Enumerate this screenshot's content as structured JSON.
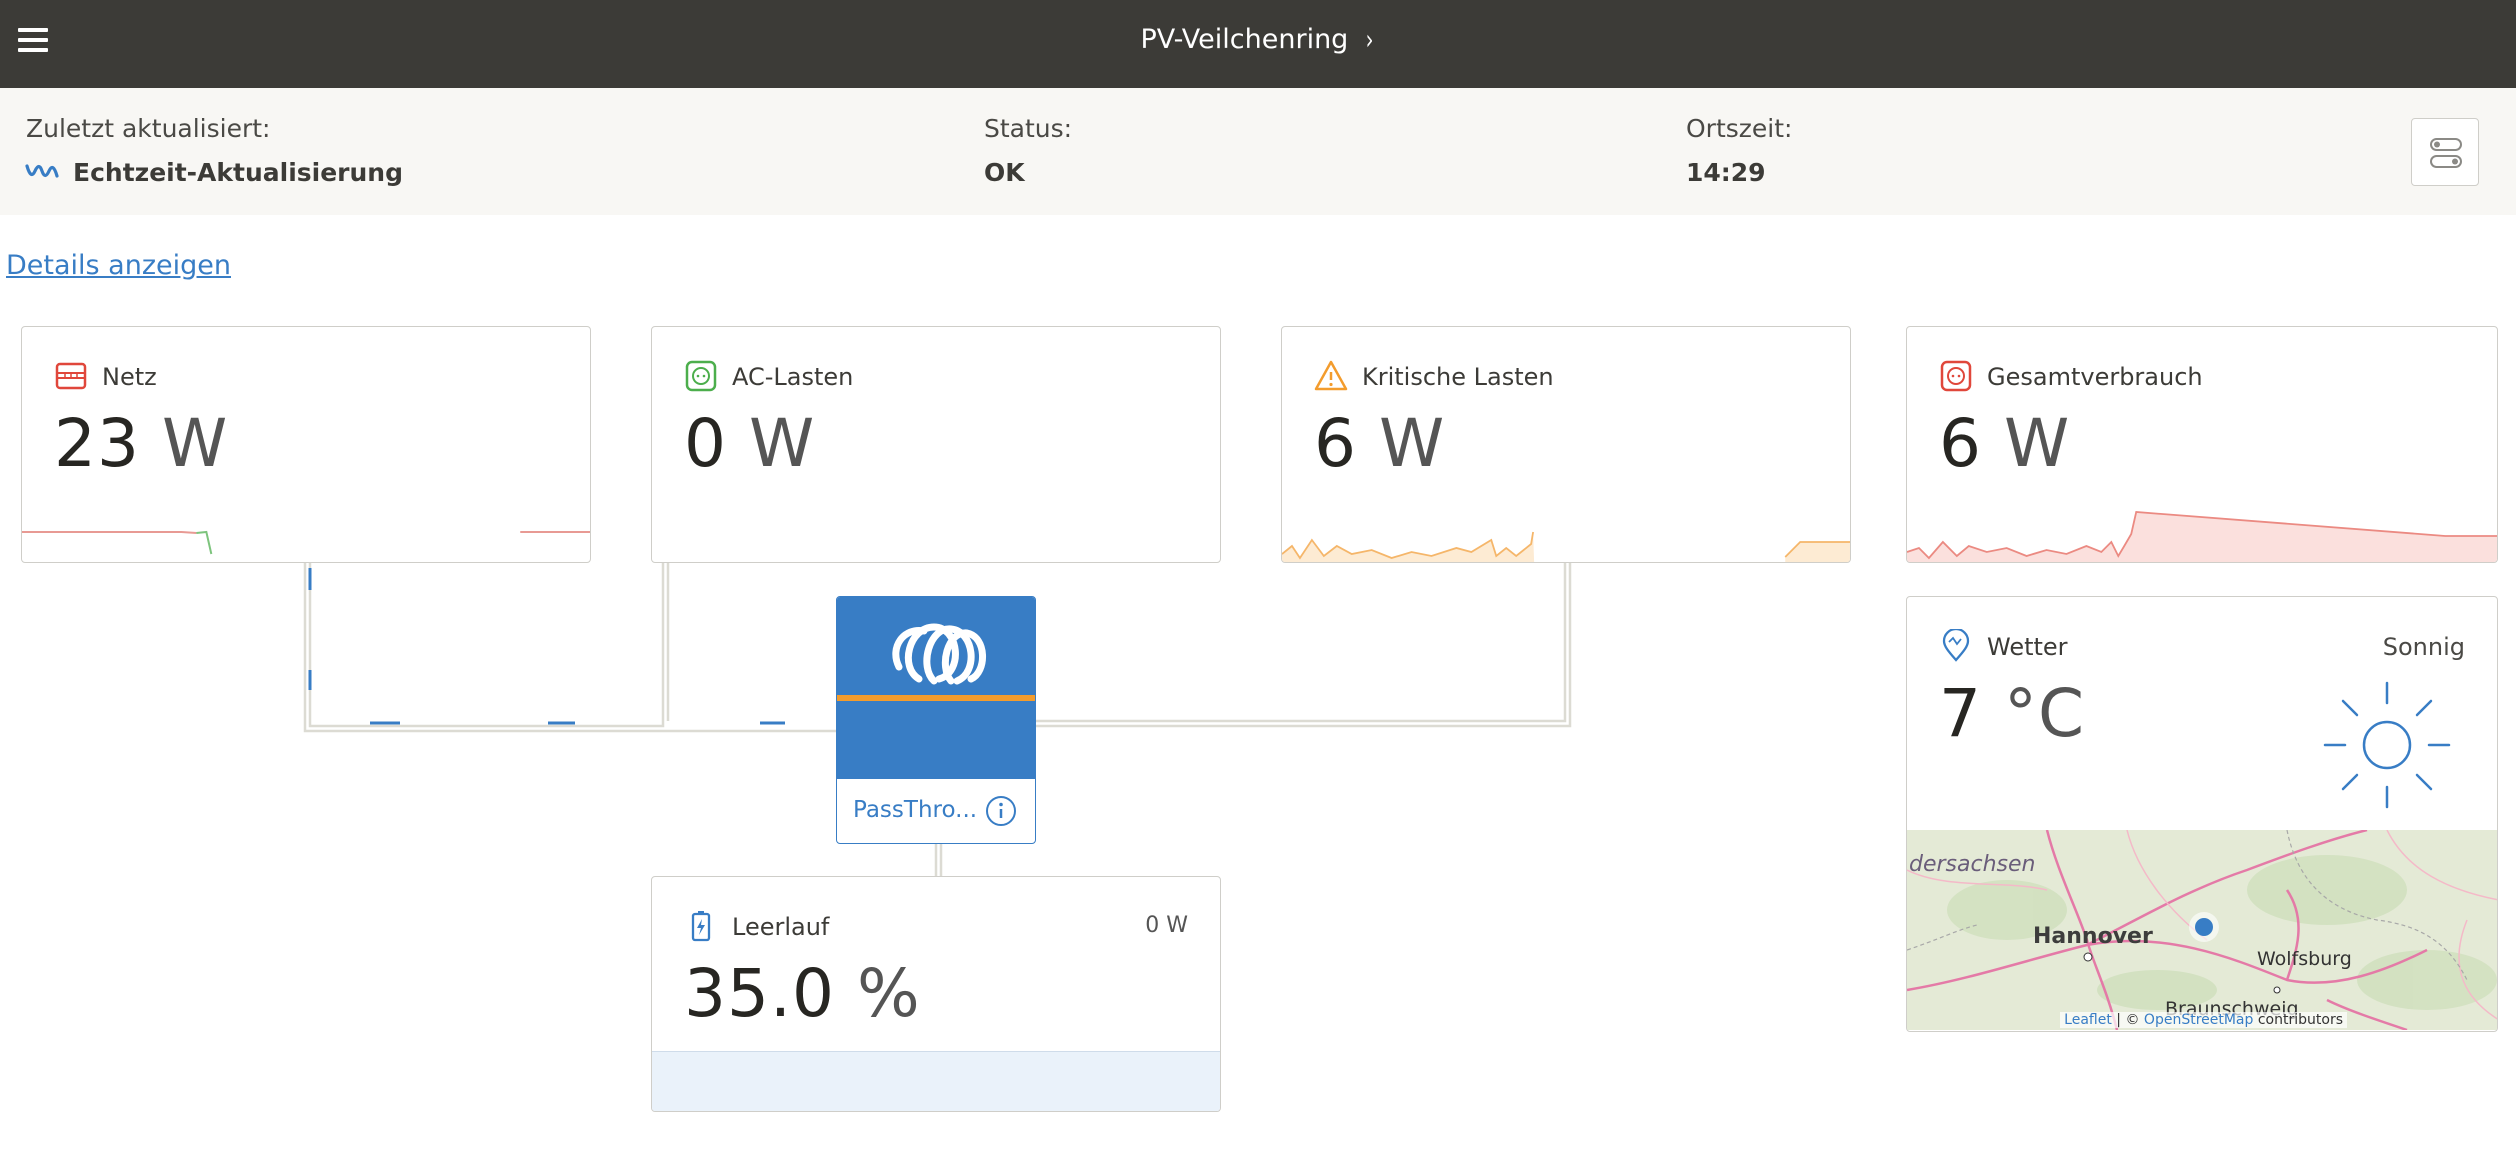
{
  "header": {
    "title": "PV-Veilchenring",
    "chevron": "›"
  },
  "info": {
    "last_updated_label": "Zuletzt aktualisiert:",
    "last_updated_value": "Echtzeit-Aktualisierung",
    "status_label": "Status:",
    "status_value": "OK",
    "local_time_label": "Ortszeit:",
    "local_time_value": "14:29"
  },
  "details_link": "Details anzeigen",
  "cards": {
    "grid": {
      "title": "Netz",
      "value": "23",
      "unit": "W",
      "icon": "grid-icon",
      "color": "#e0473b"
    },
    "ac_loads": {
      "title": "AC-Lasten",
      "value": "0",
      "unit": "W",
      "icon": "socket-icon",
      "color": "#4cae4c"
    },
    "critical_loads": {
      "title": "Kritische Lasten",
      "value": "6",
      "unit": "W",
      "icon": "warning-icon",
      "color": "#f39c2d"
    },
    "total_consumption": {
      "title": "Gesamtverbrauch",
      "value": "6",
      "unit": "W",
      "icon": "socket-icon",
      "color": "#e0473b"
    }
  },
  "inverter": {
    "label": "PassThro...",
    "icon": "victron-logo"
  },
  "battery": {
    "title": "Leerlauf",
    "power": "0 W",
    "value": "35.0",
    "unit": "%",
    "icon": "battery-icon",
    "level": 0.35
  },
  "weather": {
    "title": "Wetter",
    "state": "Sonnig",
    "temperature": "7",
    "unit": "°C",
    "icon": "location-icon",
    "map": {
      "labels": [
        "dersachsen",
        "Hannover",
        "Wolfsburg",
        "Braunschweig"
      ],
      "attribution_leaflet": "Leaflet",
      "attribution_sep": " | © ",
      "attribution_osm": "OpenStreetMap",
      "attribution_tail": " contributors"
    }
  }
}
